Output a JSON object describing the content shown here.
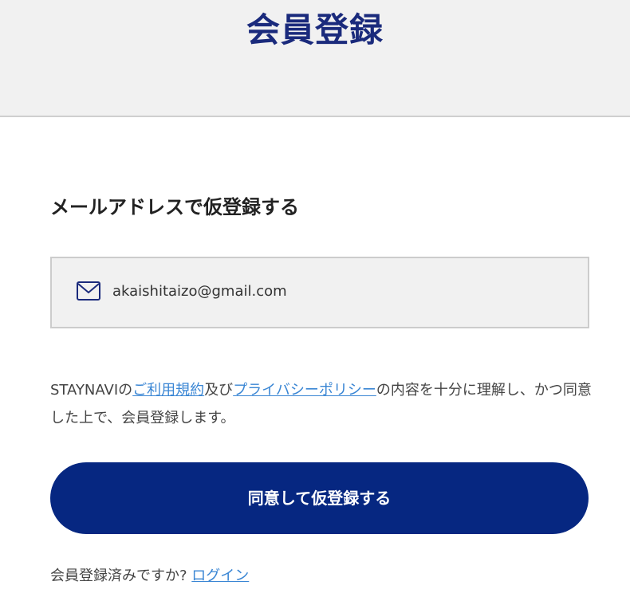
{
  "header": {
    "title": "会員登録"
  },
  "form": {
    "heading": "メールアドレスで仮登録する",
    "email_icon": "mail-icon",
    "email_value": "akaishitaizo@gmail.com"
  },
  "terms": {
    "prefix": "STAYNAVIの",
    "link1": "ご利用規約",
    "connector": "及び",
    "link2": "プライバシーポリシー",
    "suffix": "の内容を十分に理解し、かつ同意した上で、会員登録します。"
  },
  "actions": {
    "agree_button": "同意して仮登録する"
  },
  "footer": {
    "already_registered": "会員登録済みですか? ",
    "login_link": "ログイン"
  },
  "colors": {
    "brand_navy": "#062781",
    "title_navy": "#1a2a7c",
    "link_blue": "#3a86d4"
  }
}
